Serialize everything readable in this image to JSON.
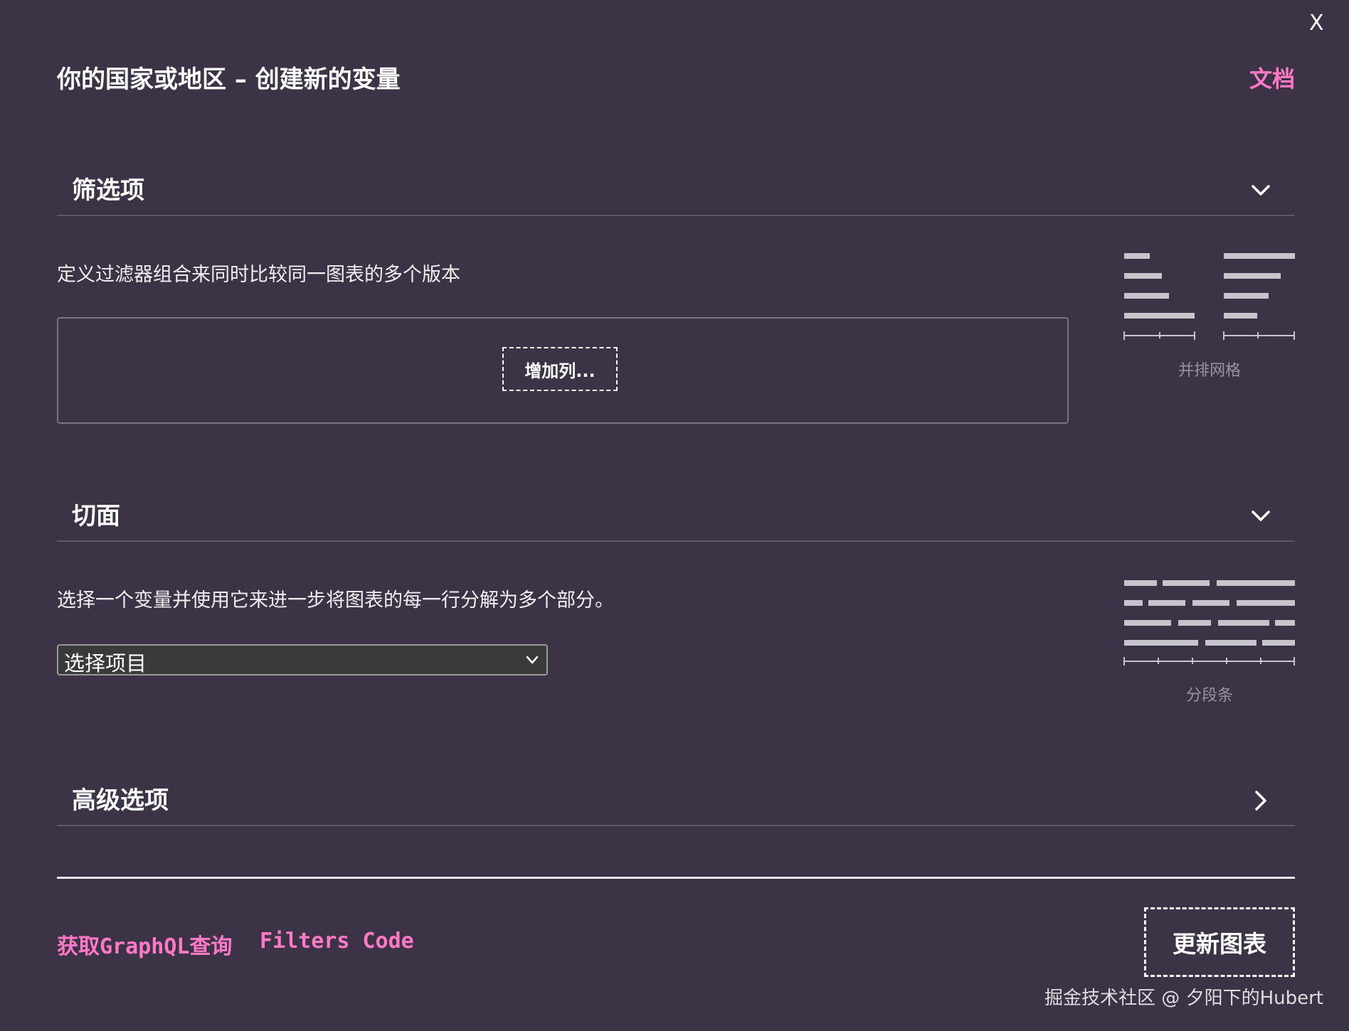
{
  "dialog": {
    "close_label": "X",
    "title": "你的国家或地区 – 创建新的变量",
    "docs_link": "文档"
  },
  "filters": {
    "heading": "筛选项",
    "description": "定义过滤器组合来同时比较同一图表的多个版本",
    "add_column_label": "增加列...",
    "viz_caption": "并排网格"
  },
  "facets": {
    "heading": "切面",
    "description": "选择一个变量并使用它来进一步将图表的每一行分解为多个部分。",
    "select_value": "选择项目",
    "viz_caption": "分段条"
  },
  "advanced": {
    "heading": "高级选项"
  },
  "footer": {
    "graphql_link": "获取GraphQL查询",
    "filters_code_link": "Filters Code",
    "update_button": "更新图表"
  },
  "watermark": "掘金技术社区 @ 夕阳下的Hubert",
  "colors": {
    "background": "#3c3446",
    "accent": "#ff79c6",
    "divider": "#5f5768",
    "caption": "#9a92a4",
    "viz_bar": "#c8c4cc"
  },
  "icons": {
    "filters_toggle": "chevron-down-icon",
    "facets_toggle": "chevron-down-icon",
    "advanced_toggle": "chevron-right-icon",
    "select_caret": "chevron-down-icon"
  }
}
